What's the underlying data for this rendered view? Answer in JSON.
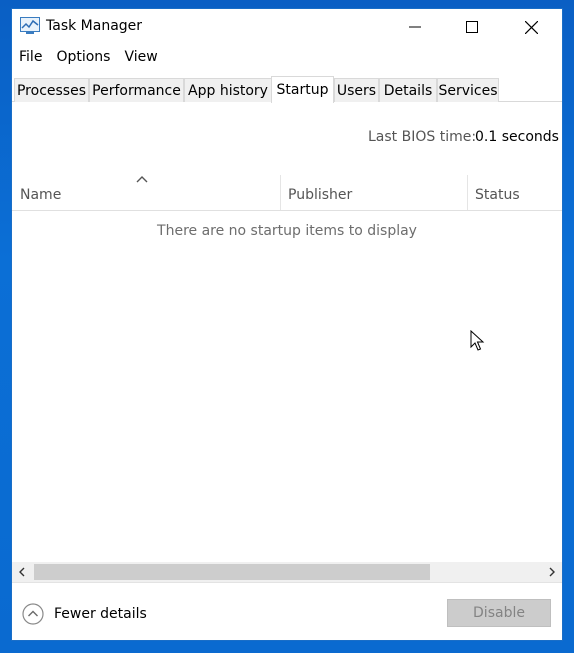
{
  "window": {
    "title": "Task Manager"
  },
  "menu": {
    "items": [
      "File",
      "Options",
      "View"
    ]
  },
  "tabs": [
    {
      "label": "Processes",
      "active": false
    },
    {
      "label": "Performance",
      "active": false
    },
    {
      "label": "App history",
      "active": false
    },
    {
      "label": "Startup",
      "active": true
    },
    {
      "label": "Users",
      "active": false
    },
    {
      "label": "Details",
      "active": false
    },
    {
      "label": "Services",
      "active": false
    }
  ],
  "startup": {
    "bios_label": "Last BIOS time:",
    "bios_value": "0.1 seconds",
    "columns": [
      "Name",
      "Publisher",
      "Status"
    ],
    "empty_message": "There are no startup items to display"
  },
  "footer": {
    "fewer_details_label": "Fewer details",
    "disable_label": "Disable",
    "disable_enabled": false
  },
  "colors": {
    "desktop": "#0b6fd6",
    "disabled_button": "#cccccc",
    "scroll_thumb": "#cdcdcd"
  }
}
